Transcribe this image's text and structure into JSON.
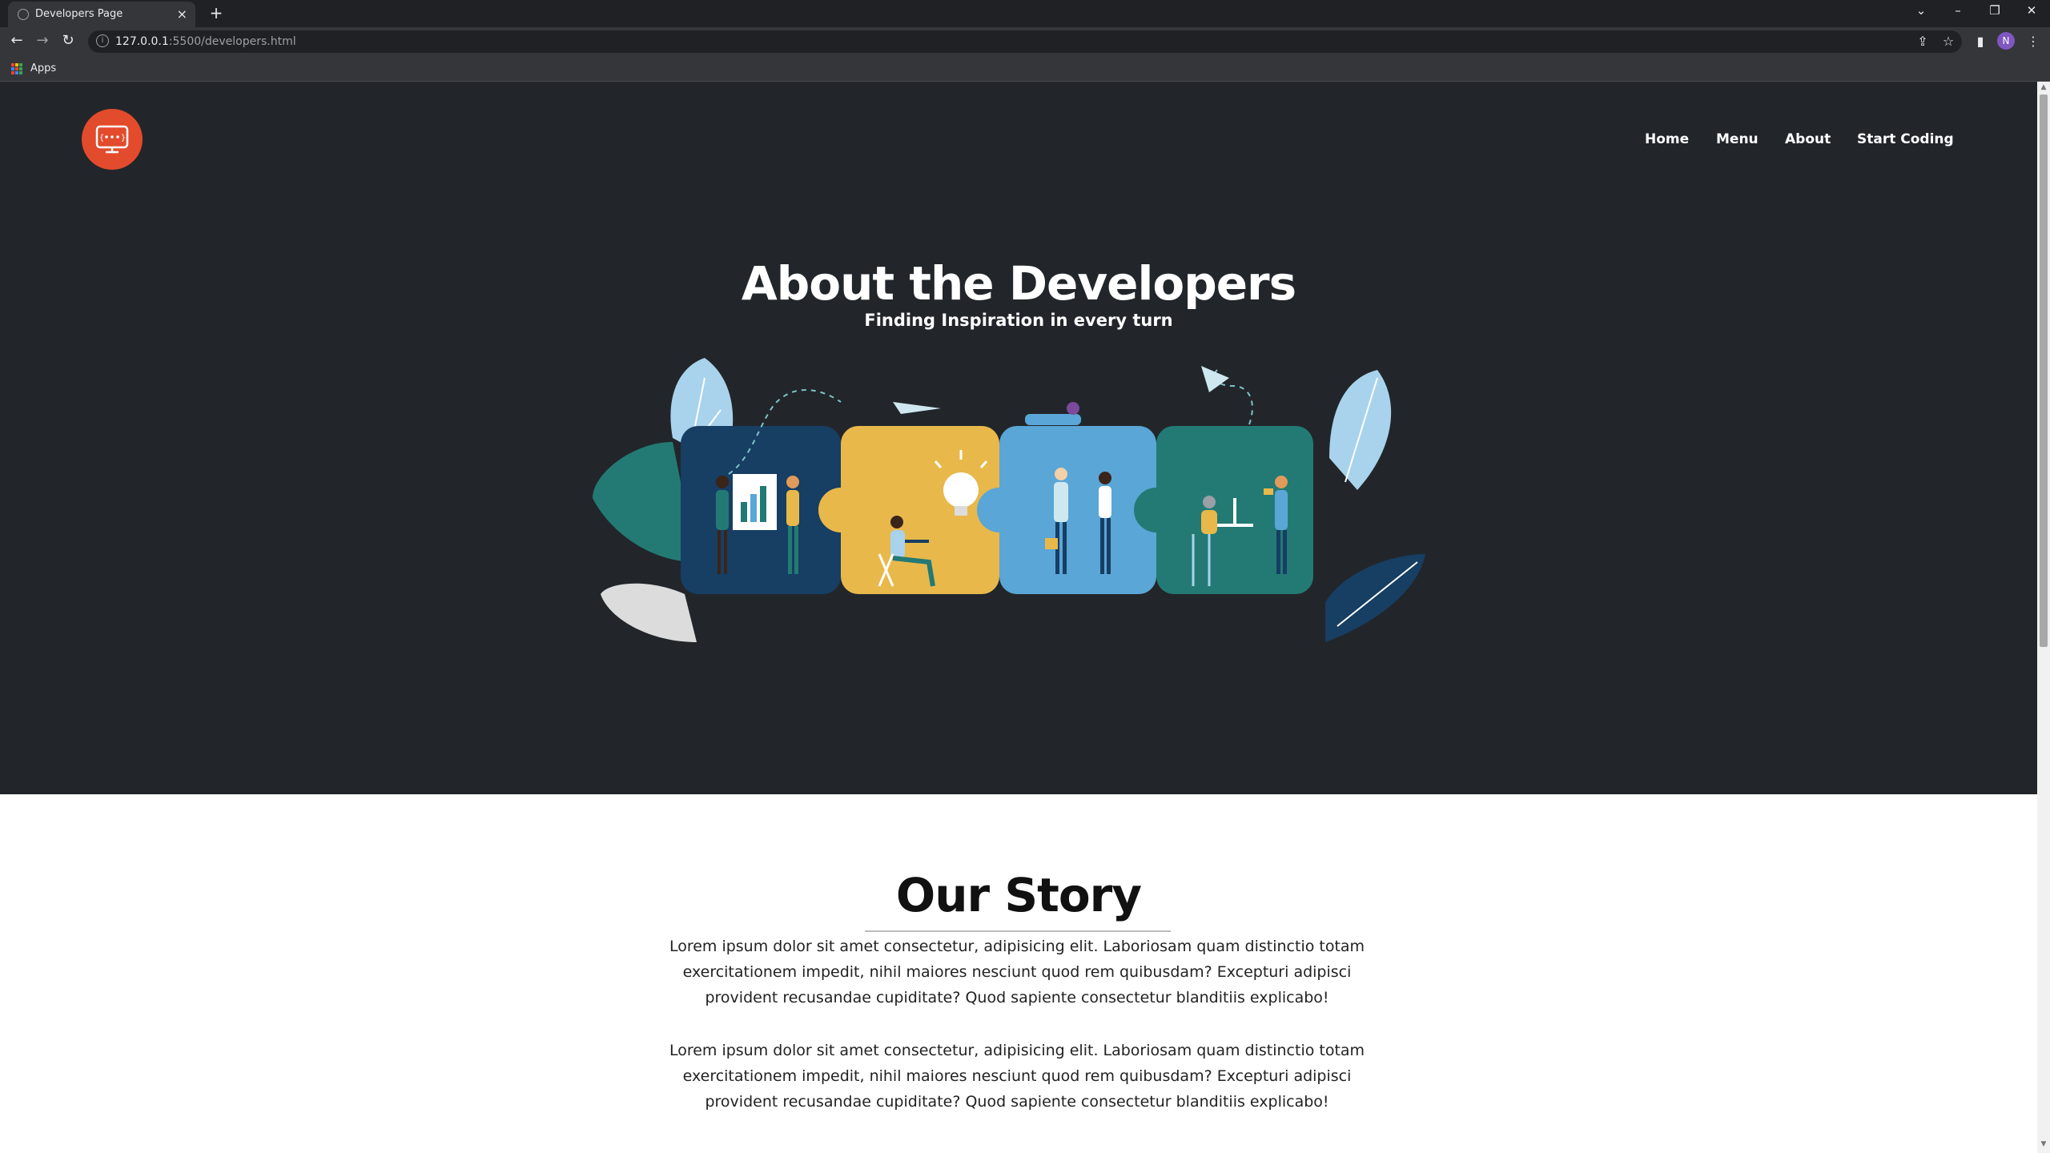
{
  "browser": {
    "tab_title": "Developers Page",
    "url_host": "127.0.0.1",
    "url_rest": ":5500/developers.html",
    "bookmarks_apps": "Apps",
    "profile_initial": "N"
  },
  "nav": {
    "items": [
      "Home",
      "Menu",
      "About",
      "Start Coding"
    ]
  },
  "hero": {
    "title": "About the Developers",
    "subtitle": "Finding Inspiration in every turn"
  },
  "story": {
    "title": "Our Story",
    "paragraphs": [
      "Lorem ipsum dolor sit amet consectetur, adipisicing elit. Laboriosam quam distinctio totam exercitationem impedit, nihil maiores nesciunt quod rem quibusdam? Excepturi adipisci provident recusandae cupiditate? Quod sapiente consectetur blanditiis explicabo!",
      "Lorem ipsum dolor sit amet consectetur, adipisicing elit. Laboriosam quam distinctio totam exercitationem impedit, nihil maiores nesciunt quod rem quibusdam? Excepturi adipisci provident recusandae cupiditate? Quod sapiente consectetur blanditiis explicabo!"
    ]
  },
  "colors": {
    "hero_bg": "#22262a",
    "logo": "#e24b2c",
    "puzzle_navy": "#173e63",
    "puzzle_yellow": "#e8b84b",
    "puzzle_blue": "#5aa6d6",
    "puzzle_teal": "#237a74"
  }
}
